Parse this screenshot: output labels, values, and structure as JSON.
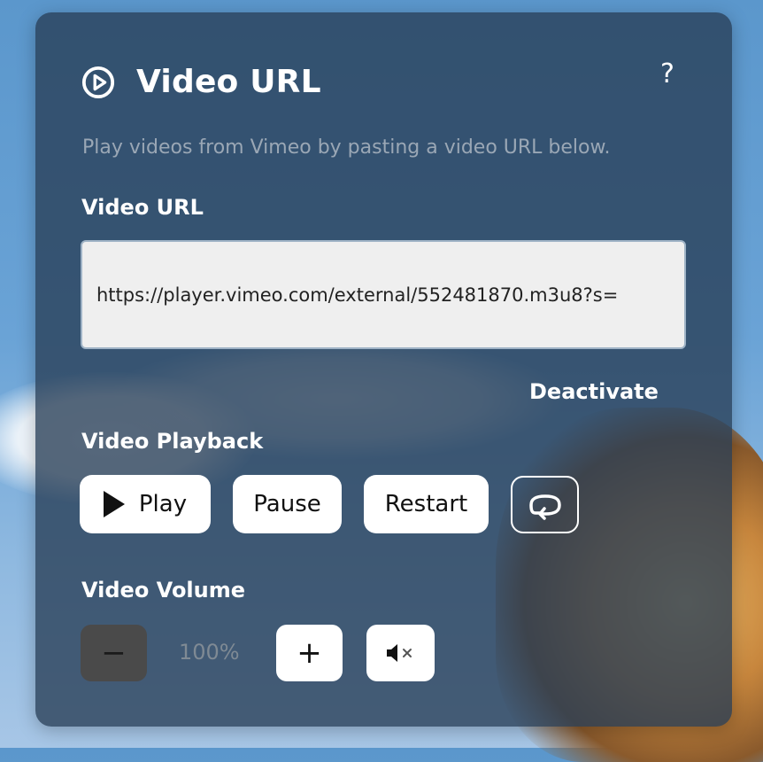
{
  "header": {
    "title": "Video URL",
    "help_label": "?",
    "description": "Play videos from Vimeo by pasting a video URL below."
  },
  "url_section": {
    "label": "Video URL",
    "value": "https://player.vimeo.com/external/552481870.m3u8?s=",
    "deactivate_label": "Deactivate"
  },
  "playback": {
    "label": "Video Playback",
    "play_label": "Play",
    "pause_label": "Pause",
    "restart_label": "Restart",
    "loop_icon": "loop-icon"
  },
  "volume": {
    "label": "Video Volume",
    "decrease_label": "−",
    "value": "100%",
    "increase_label": "+",
    "mute_icon": "mute-icon"
  },
  "colors": {
    "panel": "#283e56",
    "button_bg": "#ffffff",
    "input_bg": "#efefef",
    "disabled_btn": "#4a4a4a"
  }
}
